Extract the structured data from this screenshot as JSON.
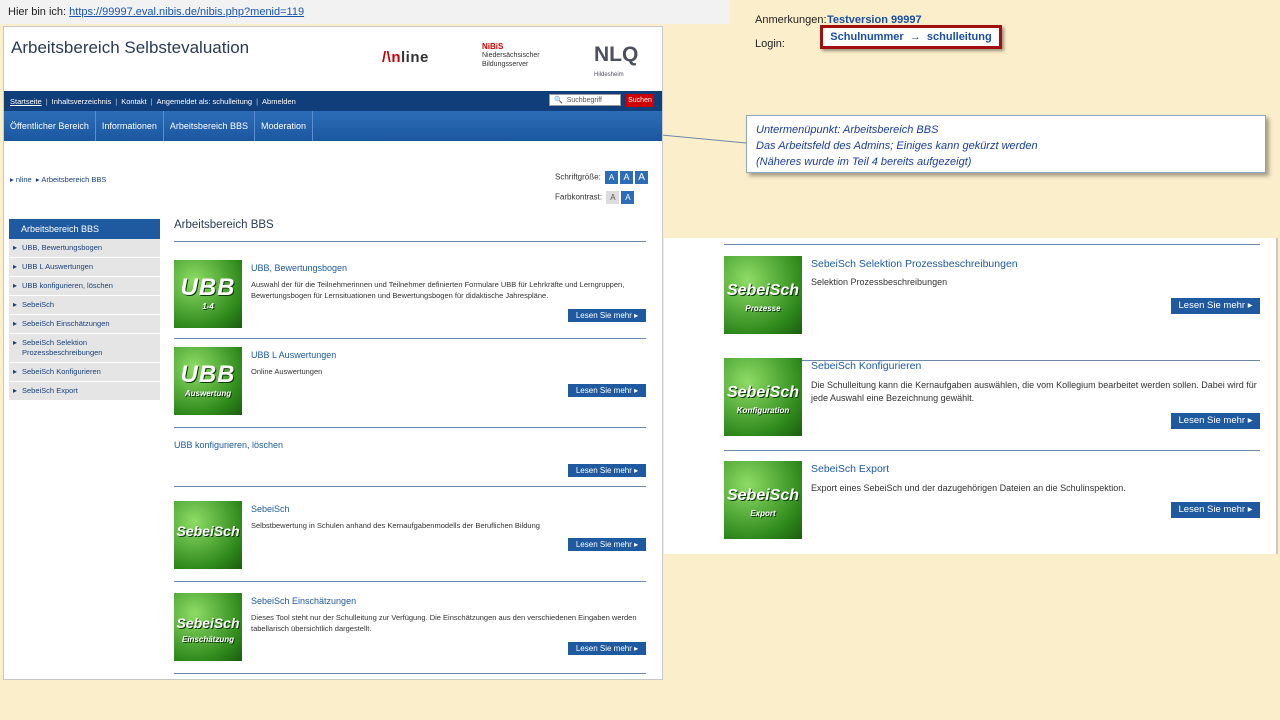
{
  "url_bar": {
    "prefix": "Hier bin ich:",
    "url": "https://99997.eval.nibis.de/nibis.php?menid=119"
  },
  "annotations": {
    "notes_label": "Anmerkungen:",
    "notes_value": "Testversion 99997",
    "login_label": "Login:",
    "login_from": "Schulnummer",
    "login_arrow": "→",
    "login_to": "schulleitung"
  },
  "callout": {
    "line1": "Untermenüpunkt: Arbeitsbereich BBS",
    "line2": "Das Arbeitsfeld des Admins; Einiges kann gekürzt werden",
    "line3": "(Näheres wurde im Teil 4 bereits aufgezeigt)"
  },
  "site": {
    "title": "Arbeitsbereich Selbstevaluation",
    "logos": {
      "nline_pre": "/\\n",
      "nline_post": "line",
      "nibis": "NiBiS",
      "nibis_text1": "Niedersächsischer",
      "nibis_text2": "Bildungsserver",
      "nlq": "NLQ",
      "nlq_sub": "Hildesheim"
    },
    "topnav": [
      "Startseite",
      "Inhaltsverzeichnis",
      "Kontakt",
      "Angemeldet als: schulleitung",
      "Abmelden"
    ],
    "search_placeholder": "Suchbegriff",
    "search_button": "Suchen",
    "mainnav": [
      "Öffentlicher Bereich",
      "Informationen",
      "Arbeitsbereich BBS",
      "Moderation"
    ],
    "breadcrumb": [
      "nline",
      "Arbeitsbereich BBS"
    ],
    "font_size_label": "Schriftgröße:",
    "contrast_label": "Farbkontrast:",
    "font_buttons": [
      "A",
      "A",
      "A"
    ],
    "contrast_buttons": [
      "A",
      "A"
    ],
    "sidebar": {
      "head": "Arbeitsbereich BBS",
      "items": [
        "UBB, Bewertungsbogen",
        "UBB L Auswertungen",
        "UBB konfigurieren, löschen",
        "SebeiSch",
        "SebeiSch Einschätzungen",
        "SebeiSch Selektion Prozessbeschreibungen",
        "SebeiSch Konfigurieren",
        "SebeiSch Export"
      ]
    },
    "content_title": "Arbeitsbereich BBS",
    "more_label": "Lesen Sie mehr",
    "entries": [
      {
        "title": "UBB, Bewertungsbogen",
        "desc": "Auswahl der für die Teilnehmerinnen und Teilnehmer definierten Formulare UBB für Lehrkräfte und Lerngruppen, Bewertungsbogen für Lernsituationen und Bewertungsbogen für didaktische Jahrespläne.",
        "thumb_main": "UBB",
        "thumb_sub": "1-4"
      },
      {
        "title": "UBB L Auswertungen",
        "desc": "Online Auswertungen",
        "thumb_main": "UBB",
        "thumb_sub": "Auswertung"
      },
      {
        "title": "UBB konfigurieren, löschen",
        "desc": ""
      },
      {
        "title": "SebeiSch",
        "desc": "Selbstbewertung in Schulen anhand des Kernaufgabenmodells der Beruflichen Bildung",
        "thumb_main": "SebeiSch",
        "thumb_sub": ""
      },
      {
        "title": "SebeiSch Einschätzungen",
        "desc": "Dieses Tool steht nur der Schulleitung zur Verfügung. Die Einschätzungen aus den verschiedenen Eingaben werden tabellarisch übersichtlich dargestellt.",
        "thumb_main": "SebeiSch",
        "thumb_sub": "Einschätzung"
      }
    ]
  },
  "panel2": {
    "entries": [
      {
        "title": "SebeiSch Selektion Prozessbeschreibungen",
        "desc": "Selektion Prozessbeschreibungen",
        "thumb_main": "SebeiSch",
        "thumb_sub": "Prozesse"
      },
      {
        "title": "SebeiSch Konfigurieren",
        "desc": "Die Schulleitung kann die Kernaufgaben auswählen, die vom Kollegium bearbeitet werden sollen. Dabei wird für jede Auswahl eine Bezeichnung gewählt.",
        "thumb_main": "SebeiSch",
        "thumb_sub": "Konfiguration"
      },
      {
        "title": "SebeiSch Export",
        "desc": "Export eines SebeiSch und der dazugehörigen Dateien an die Schulinspektion.",
        "thumb_main": "SebeiSch",
        "thumb_sub": "Export"
      }
    ]
  }
}
